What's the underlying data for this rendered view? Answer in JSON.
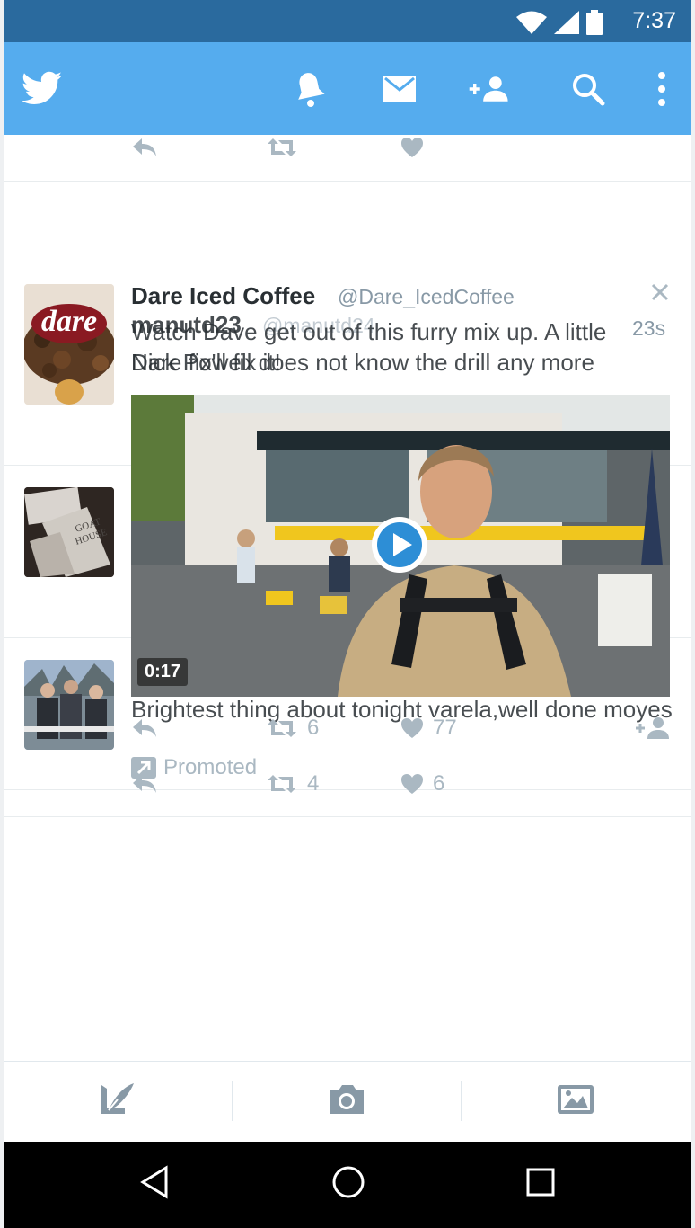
{
  "status_bar": {
    "time": "7:37"
  },
  "app_bar": {
    "icons": [
      "twitter-bird-icon",
      "notifications-bell-icon",
      "messages-envelope-icon",
      "follow-add-user-icon",
      "search-icon",
      "overflow-menu-icon"
    ]
  },
  "promoted_tweet": {
    "display_name": "Dare Iced Coffee",
    "handle": "@Dare_IcedCoffee",
    "text": "Watch Dave get out of this furry mix up. A little Dare fix'll fix it!",
    "video_duration": "0:17",
    "retweets": "6",
    "likes": "77",
    "promoted_label": "Promoted"
  },
  "underlying_tweet_1": {
    "display_name": "manutd23",
    "handle": "@manutd24",
    "time": "23s",
    "text": "Nick Powell does not know the drill any more"
  },
  "underlying_tweet_3": {
    "text": "Brightest thing about tonight varela,well done moyes",
    "retweets": "4",
    "likes": "6"
  },
  "bottom_toolbar": {
    "icons": [
      "compose-tweet-icon",
      "camera-icon",
      "gallery-image-icon"
    ]
  },
  "system_nav": {
    "icons": [
      "back-triangle-icon",
      "home-circle-icon",
      "recents-square-icon"
    ]
  },
  "colors": {
    "app_bar": "#55acee",
    "status_bar": "#2a6a9e",
    "action_gray": "#aab8c2"
  }
}
